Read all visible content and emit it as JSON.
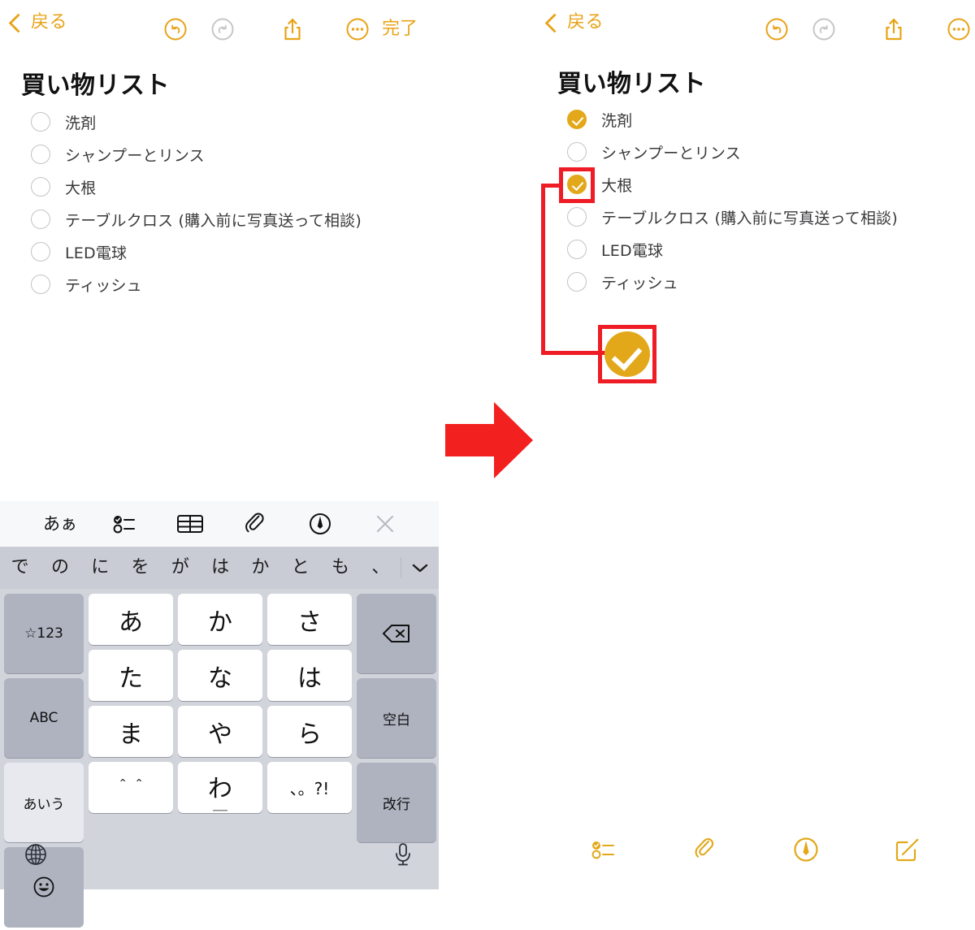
{
  "colors": {
    "accent_gold": "#E3A81A",
    "nav_gold": "#E8A317",
    "callout_red": "#EE1C25",
    "keyboard_bg": "#d1d4db",
    "suggest_bg": "#c9ccd4"
  },
  "left": {
    "nav": {
      "back_label": "戻る",
      "done_label": "完了",
      "icons": [
        "undo-icon",
        "redo-icon",
        "share-icon",
        "more-icon"
      ]
    },
    "title": "買い物リスト",
    "items": [
      {
        "label": "洗剤",
        "checked": false
      },
      {
        "label": "シャンプーとリンス",
        "checked": false
      },
      {
        "label": "大根",
        "checked": false
      },
      {
        "label": "テーブルクロス (購入前に写真送って相談)",
        "checked": false
      },
      {
        "label": "LED電球",
        "checked": false
      },
      {
        "label": "ティッシュ",
        "checked": false
      }
    ]
  },
  "right": {
    "nav": {
      "back_label": "戻る",
      "icons": [
        "undo-icon",
        "redo-icon",
        "share-icon",
        "more-icon"
      ]
    },
    "title": "買い物リスト",
    "items": [
      {
        "label": "洗剤",
        "checked": true
      },
      {
        "label": "シャンプーとリンス",
        "checked": false
      },
      {
        "label": "大根",
        "checked": true
      },
      {
        "label": "テーブルクロス (購入前に写真送って相談)",
        "checked": false
      },
      {
        "label": "LED電球",
        "checked": false
      },
      {
        "label": "ティッシュ",
        "checked": false
      }
    ],
    "bottom_toolbar": [
      "checklist-icon",
      "attachment-icon",
      "markup-icon",
      "compose-icon"
    ]
  },
  "keyboard": {
    "accessory": {
      "text_style_label": "あぁ",
      "items": [
        "text-style",
        "checklist-icon",
        "table-icon",
        "attachment-icon",
        "markup-icon",
        "close-icon"
      ]
    },
    "suggestions": [
      "で",
      "の",
      "に",
      "を",
      "が",
      "は",
      "か",
      "と",
      "も",
      "、"
    ],
    "keys": {
      "num_label": "☆123",
      "abc_label": "ABC",
      "kana_label": "あいう",
      "emoji_label": "emoji-icon",
      "delete_label": "delete-icon",
      "space_label": "空白",
      "return_label": "改行",
      "grid": [
        [
          "あ",
          "か",
          "さ"
        ],
        [
          "た",
          "な",
          "は"
        ],
        [
          "ま",
          "や",
          "ら"
        ],
        [
          "＾＾",
          "わ",
          "、。?!"
        ]
      ],
      "wa_under": "＿"
    },
    "bottom": {
      "globe": "globe-icon",
      "mic": "mic-icon"
    }
  }
}
